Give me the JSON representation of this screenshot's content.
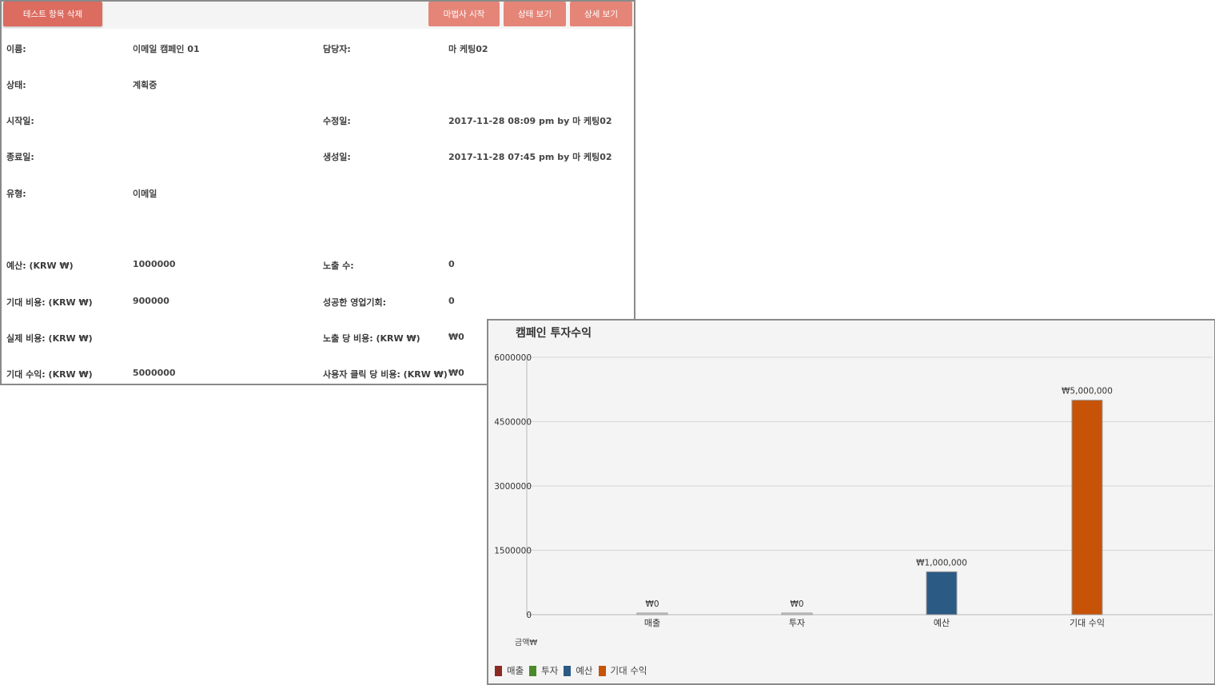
{
  "toolbar": {
    "delete_label": "테스트 항목 삭제",
    "wizard_label": "마법사 시작",
    "status_label": "상태 보기",
    "detail_label": "상세 보기"
  },
  "fields": {
    "name_label": "이름:",
    "name_value": "이메일 캠페인 01",
    "owner_label": "담당자:",
    "owner_value": "마 케팅02",
    "status_label": "상태:",
    "status_value": "계획중",
    "start_label": "시작일:",
    "start_value": "",
    "modified_label": "수정일:",
    "modified_value": "2017-11-28 08:09 pm by 마 케팅02",
    "end_label": "종료일:",
    "end_value": "",
    "created_label": "생성일:",
    "created_value": "2017-11-28 07:45 pm by 마 케팅02",
    "type_label": "유형:",
    "type_value": "이메일",
    "budget_label": "예산: (KRW ₩)",
    "budget_value": "1000000",
    "impressions_label": "노출 수:",
    "impressions_value": "0",
    "expected_cost_label": "기대 비용: (KRW ₩)",
    "expected_cost_value": "900000",
    "won_opps_label": "성공한 영업기회:",
    "won_opps_value": "0",
    "actual_cost_label": "실제 비용: (KRW ₩)",
    "actual_cost_value": "",
    "cost_per_impression_label": "노출 당 비용: (KRW ₩)",
    "cost_per_impression_value": "₩0",
    "expected_revenue_label": "기대 수익: (KRW ₩)",
    "expected_revenue_value": "5000000",
    "cost_per_click_label": "사용자 클릭 당 비용: (KRW ₩)",
    "cost_per_click_value": "₩0"
  },
  "chart_data": {
    "type": "bar",
    "title": "캠페인 투자수익",
    "xlabel": "",
    "ylabel": "금액₩",
    "categories": [
      "매출",
      "투자",
      "예산",
      "기대 수익"
    ],
    "values": [
      0,
      0,
      1000000,
      5000000
    ],
    "data_labels": [
      "₩0",
      "₩0",
      "₩1,000,000",
      "₩5,000,000"
    ],
    "colors": [
      "#8b2a22",
      "#4a8a2a",
      "#2b5a84",
      "#c65308"
    ],
    "y_ticks": [
      0,
      1500000,
      3000000,
      4500000,
      6000000
    ],
    "y_tick_labels": [
      "0",
      "1500000",
      "3000000",
      "4500000",
      "6000000"
    ],
    "ylim": [
      0,
      6000000
    ],
    "grid": true,
    "legend": "bottom-left",
    "legend_entries": [
      "매출",
      "투자",
      "예산",
      "기대 수익"
    ]
  }
}
